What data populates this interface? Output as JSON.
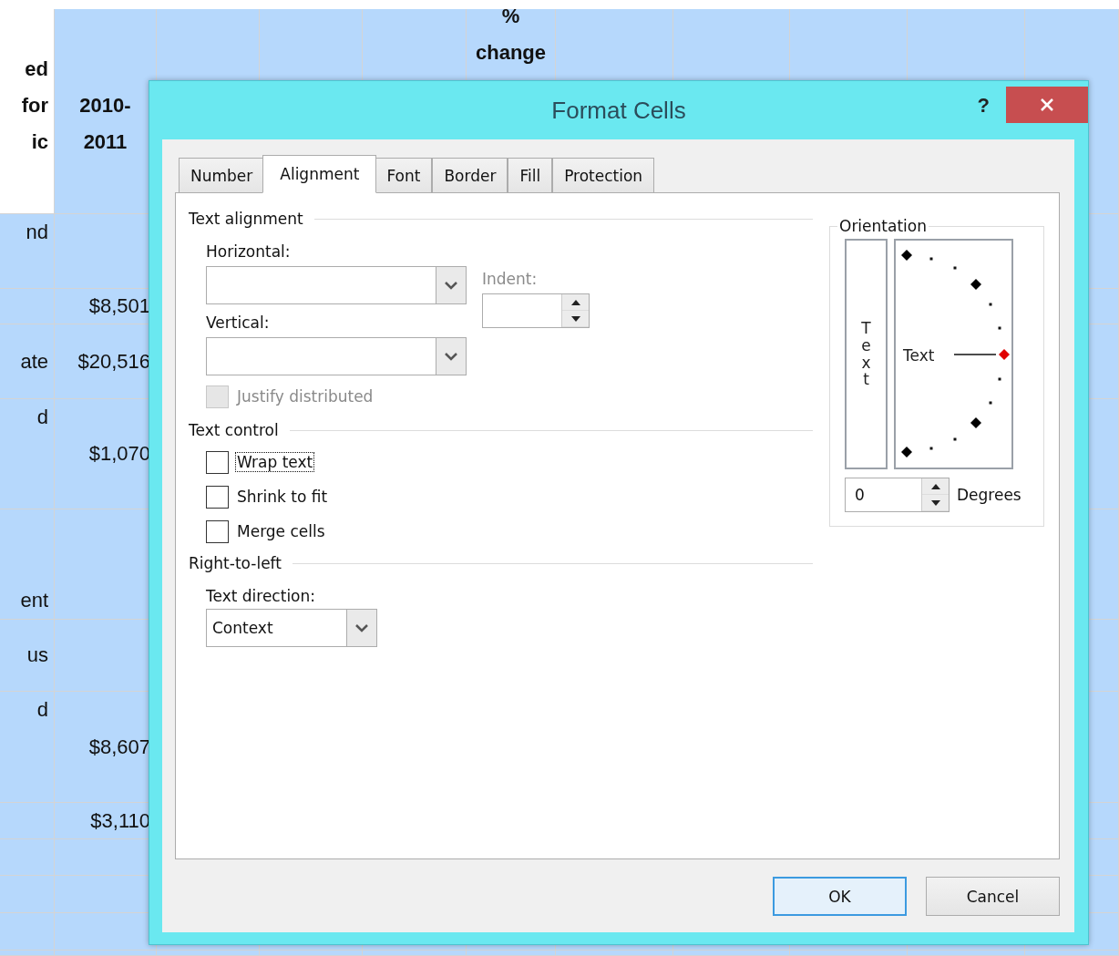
{
  "sheet": {
    "header": {
      "column_1": "ed\nfor\nic",
      "column_2": "2010-\n2011",
      "column_6": "%\nchange"
    },
    "rows": [
      {
        "column_1": "nd"
      },
      {
        "column_2": "$8,501"
      },
      {
        "column_1": "ate",
        "column_2": "$20,516"
      },
      {
        "column_1": "d",
        "column_2": "$1,070"
      },
      {
        "column_1": "ent"
      },
      {
        "column_1": "us"
      },
      {
        "column_1": "d",
        "column_2": "$8,607"
      },
      {
        "column_2": "$3,110"
      },
      {},
      {},
      {},
      {}
    ]
  },
  "dialog": {
    "title": "Format Cells",
    "help": "?",
    "tabs": [
      {
        "label": "Number",
        "selected": false
      },
      {
        "label": "Alignment",
        "selected": true
      },
      {
        "label": "Font",
        "selected": false
      },
      {
        "label": "Border",
        "selected": false
      },
      {
        "label": "Fill",
        "selected": false
      },
      {
        "label": "Protection",
        "selected": false
      }
    ],
    "text_alignment": {
      "heading": "Text alignment",
      "horizontal_label": "Horizontal:",
      "vertical_label": "Vertical:",
      "indent_label": "Indent:",
      "justify_distributed": {
        "label": "Justify distributed",
        "checked": false,
        "disabled": true
      }
    },
    "text_control": {
      "heading": "Text control",
      "options": [
        {
          "label": "Wrap text",
          "checked": false,
          "focused": true
        },
        {
          "label": "Shrink to fit",
          "checked": false,
          "focused": false
        },
        {
          "label": "Merge cells",
          "checked": false,
          "focused": false
        }
      ]
    },
    "right_to_left": {
      "heading": "Right-to-left",
      "direction_label": "Text direction:",
      "direction_value": "Context"
    },
    "orientation": {
      "heading": "Orientation",
      "vertical_text": "Text",
      "dial_text": "Text",
      "degrees_value": "0",
      "degrees_label": "Degrees"
    },
    "buttons": [
      {
        "label": "OK",
        "default": true
      },
      {
        "label": "Cancel",
        "default": false
      }
    ]
  }
}
